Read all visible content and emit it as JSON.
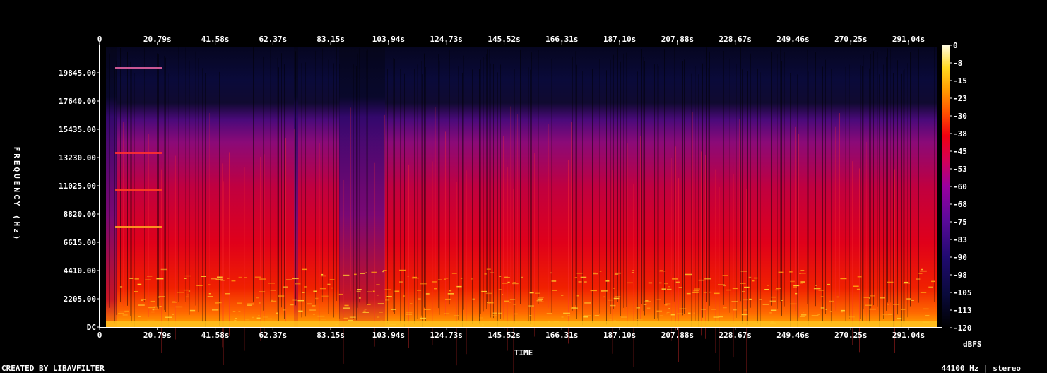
{
  "chart_data": {
    "type": "heatmap",
    "title": "",
    "xlabel": "TIME",
    "ylabel": "FREQUENCY (Hz)",
    "x_ticks": [
      "0",
      "20.79s",
      "41.58s",
      "62.37s",
      "83.15s",
      "103.94s",
      "124.73s",
      "145.52s",
      "166.31s",
      "187.10s",
      "207.88s",
      "228.67s",
      "249.46s",
      "270.25s",
      "291.04s"
    ],
    "x_tick_values": [
      0,
      20.79,
      41.58,
      62.37,
      83.15,
      103.94,
      124.73,
      145.52,
      166.31,
      187.1,
      207.88,
      228.67,
      249.46,
      270.25,
      291.04
    ],
    "xlim": [
      0,
      305
    ],
    "y_ticks": [
      "DC",
      "2205.00",
      "4410.00",
      "6615.00",
      "8820.00",
      "11025.00",
      "13230.00",
      "15435.00",
      "17640.00",
      "19845.00"
    ],
    "y_tick_values": [
      0,
      2205,
      4410,
      6615,
      8820,
      11025,
      13230,
      15435,
      17640,
      19845
    ],
    "ylim": [
      0,
      22050
    ],
    "colorbar": {
      "label": "dBFS",
      "ticks": [
        "0",
        "-8",
        "-15",
        "-23",
        "-30",
        "-38",
        "-45",
        "-53",
        "-60",
        "-68",
        "-75",
        "-83",
        "-90",
        "-98",
        "-105",
        "-113",
        "-120"
      ],
      "range": [
        -120,
        0
      ]
    },
    "sample_rate_hz": 44100,
    "channels": "stereo"
  },
  "footer": {
    "left": "CREATED BY LIBAVFILTER",
    "right": "44100 Hz | stereo"
  }
}
